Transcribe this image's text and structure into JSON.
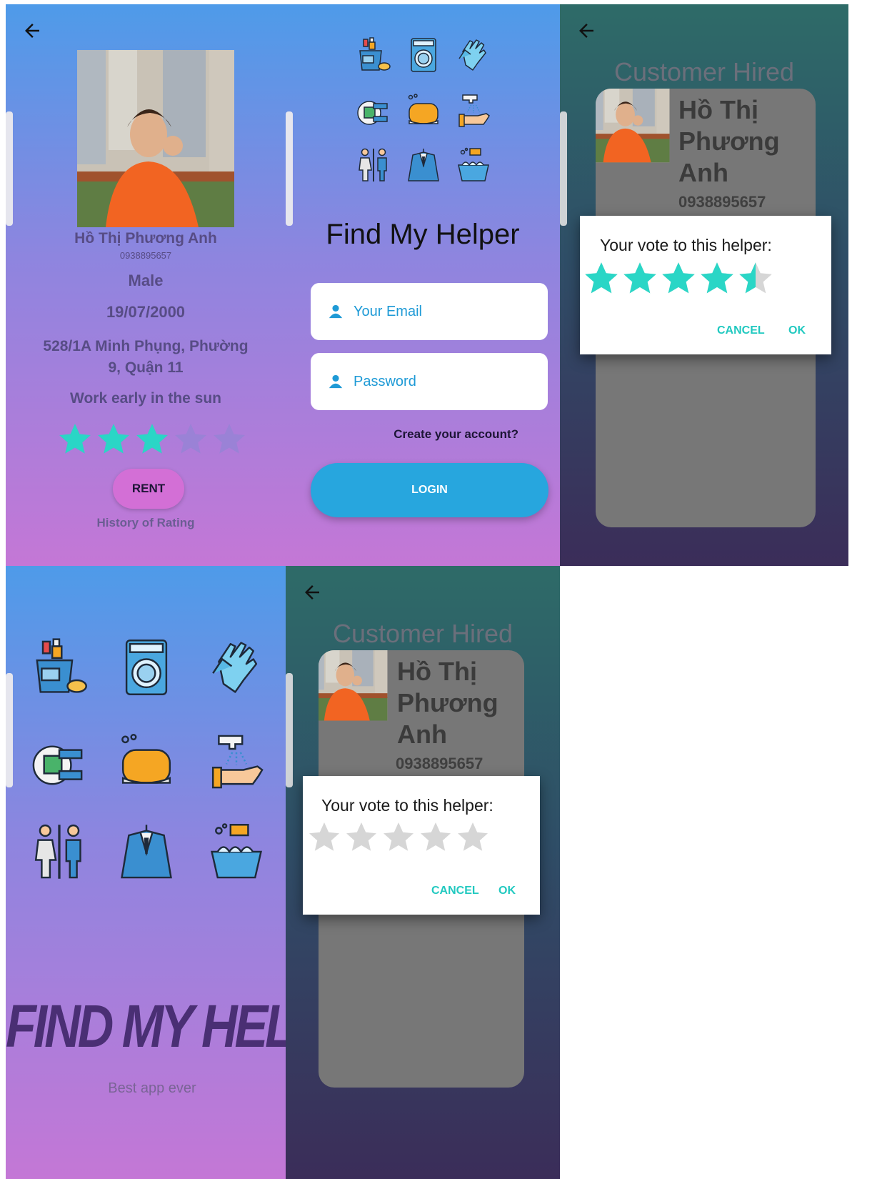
{
  "profile": {
    "name": "Hồ Thị Phương Anh",
    "phone": "0938895657",
    "gender": "Male",
    "dob": "19/07/2000",
    "address": "528/1A Minh Phụng, Phường 9, Quận 11",
    "description": "Work early in the sun",
    "rating": 3,
    "rating_max": 5,
    "rent_label": "RENT",
    "history_link": "History of Rating"
  },
  "login": {
    "app_title": "Find My Helper",
    "email_placeholder": "Your Email",
    "password_placeholder": "Password",
    "create_account": "Create your account?",
    "login_label": "LOGIN"
  },
  "vote_dialog_filled": {
    "screen_title": "Customer Hired",
    "card_name": "Hồ Thị Phương Anh",
    "card_phone": "0938895657",
    "prompt": "Your vote to this helper:",
    "rating": 4.5,
    "rating_max": 5,
    "cancel_label": "CANCEL",
    "ok_label": "OK"
  },
  "splash": {
    "title": "FIND MY HELPER",
    "tagline": "Best app ever"
  },
  "vote_dialog_empty": {
    "screen_title": "Customer Hired",
    "card_name": "Hồ Thị Phương Anh",
    "card_phone": "0938895657",
    "prompt": "Your vote to this helper:",
    "rating": 0,
    "rating_max": 5,
    "cancel_label": "CANCEL",
    "ok_label": "OK"
  },
  "colors": {
    "star_active": "#2ad6c6",
    "star_inactive_profile": "#9a82d6",
    "star_inactive_dialog": "#d6d6d6"
  },
  "icons": [
    "cleaning-supplies-icon",
    "washing-machine-icon",
    "rubber-gloves-icon",
    "dish-washing-icon",
    "soap-bar-icon",
    "hand-washing-icon",
    "restroom-icon",
    "suit-icon",
    "laundry-basin-icon"
  ]
}
